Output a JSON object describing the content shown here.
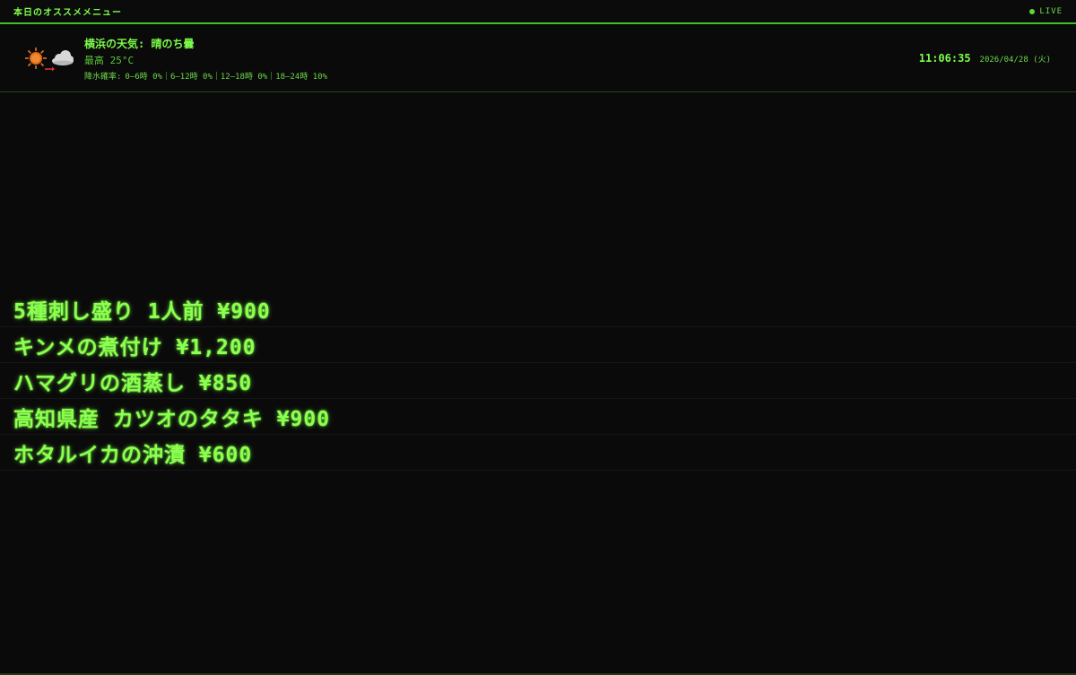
{
  "header": {
    "title": "本日のオススメメニュー",
    "live_label": "LIVE"
  },
  "weather": {
    "icon": "sun-and-cloud-icon",
    "title": "横浜の天気: 晴のち曇",
    "high": "最高 25°C",
    "rain_label": "降水確率:",
    "rain": [
      "0–6時 0%",
      "6–12時 0%",
      "12–18時 0%",
      "18–24時 10%"
    ]
  },
  "clock": {
    "time": "11:06:35",
    "date": "2026/04/28 (火)"
  },
  "menu": {
    "items": [
      "5種刺し盛り 1人前 ¥900",
      "キンメの煮付け ¥1,200",
      "ハマグリの酒蒸し ¥850",
      "高知県産 カツオのタタキ ¥900",
      "ホタルイカの沖漬 ¥600"
    ]
  },
  "colors": {
    "accent": "#7CFC4A",
    "background": "#0a0a0a"
  }
}
